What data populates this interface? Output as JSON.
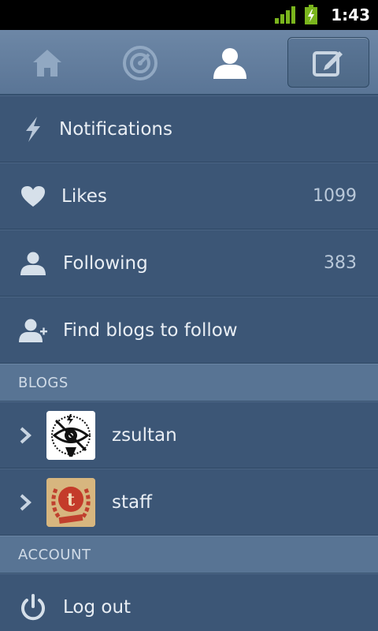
{
  "status_bar": {
    "time": "1:43"
  },
  "nav": {
    "icons": [
      "home-icon",
      "explore-icon",
      "account-icon",
      "compose-icon"
    ]
  },
  "menu": {
    "notifications": {
      "label": "Notifications",
      "icon": "lightning-icon"
    },
    "likes": {
      "label": "Likes",
      "count": "1099",
      "icon": "heart-icon"
    },
    "following": {
      "label": "Following",
      "count": "383",
      "icon": "person-icon"
    },
    "find_blogs": {
      "label": "Find blogs to follow",
      "icon": "add-person-icon"
    }
  },
  "blogs": {
    "header": "BLOGS",
    "items": [
      {
        "name": "zsultan",
        "avatar": "eye-avatar"
      },
      {
        "name": "staff",
        "avatar": "tumblr-t-avatar"
      }
    ]
  },
  "account": {
    "header": "ACCOUNT",
    "logout": {
      "label": "Log out",
      "icon": "power-icon"
    }
  },
  "colors": {
    "background": "#3c5676",
    "nav": "#5a7596",
    "section": "#587494"
  }
}
